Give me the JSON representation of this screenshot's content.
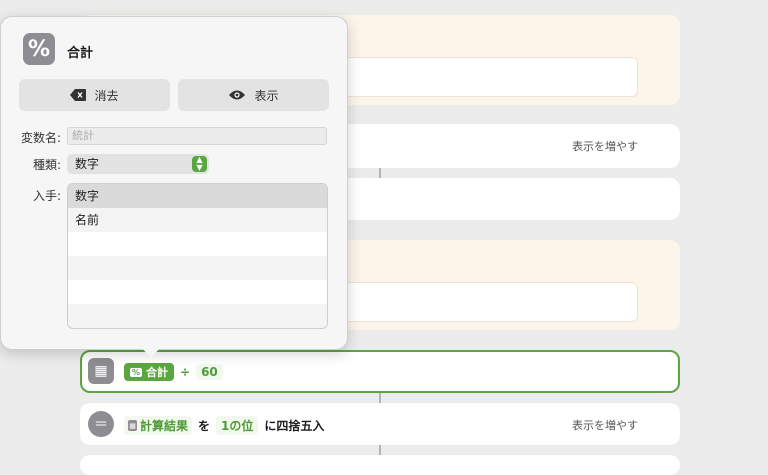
{
  "popover": {
    "icon_glyph": "%",
    "title": "合計",
    "clear_label": "消去",
    "show_label": "表示",
    "var_name_label": "変数名:",
    "var_name_placeholder": "統計",
    "type_label": "種類:",
    "type_value": "数字",
    "get_label": "入手:",
    "options": [
      "数字",
      "名前"
    ]
  },
  "show_more_1": "表示を増やす",
  "calc_action": {
    "var_glyph": "%",
    "variable": "合計",
    "operator": "÷",
    "operand": "60"
  },
  "round_action": {
    "variable": "計算結果",
    "particle": "を",
    "place": "1の位",
    "verb": "に四捨五入",
    "show_more": "表示を増やす"
  },
  "colors": {
    "accent_green": "#5aa73f",
    "beige": "#fcf5ea"
  }
}
